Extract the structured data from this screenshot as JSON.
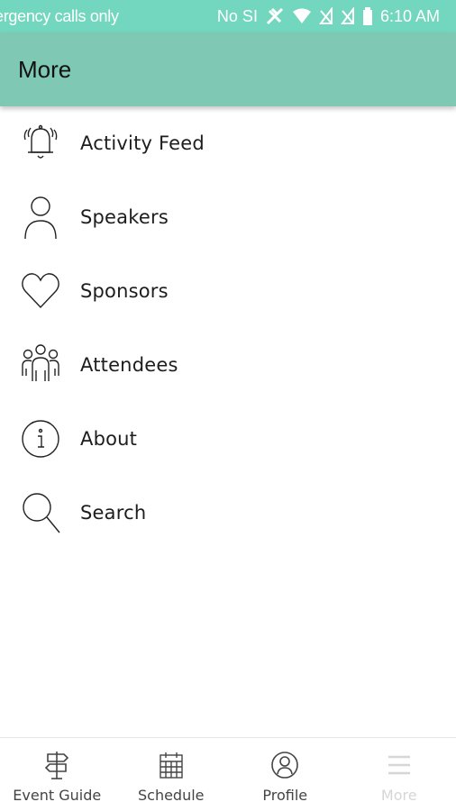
{
  "status_bar": {
    "carrier_text": "ergency calls only",
    "sim_text": "No SI",
    "time": "6:10 AM",
    "icons": [
      "no-sim-icon",
      "wifi-icon",
      "signal-off-icon",
      "signal-off-icon",
      "battery-icon"
    ]
  },
  "app_bar": {
    "title": "More"
  },
  "menu": {
    "items": [
      {
        "label": "Activity Feed",
        "icon": "bell-icon"
      },
      {
        "label": "Speakers",
        "icon": "person-icon"
      },
      {
        "label": "Sponsors",
        "icon": "heart-icon"
      },
      {
        "label": "Attendees",
        "icon": "people-icon"
      },
      {
        "label": "About",
        "icon": "info-icon"
      },
      {
        "label": "Search",
        "icon": "search-icon"
      }
    ]
  },
  "bottom_nav": {
    "items": [
      {
        "label": "Event Guide",
        "icon": "signpost-icon",
        "active": false
      },
      {
        "label": "Schedule",
        "icon": "calendar-icon",
        "active": false
      },
      {
        "label": "Profile",
        "icon": "profile-icon",
        "active": false
      },
      {
        "label": "More",
        "icon": "menu-icon",
        "active": true
      }
    ]
  },
  "colors": {
    "status_bar": "#72d7be",
    "app_bar": "#7ec8b4",
    "active_nav": "#d6d6d6"
  }
}
